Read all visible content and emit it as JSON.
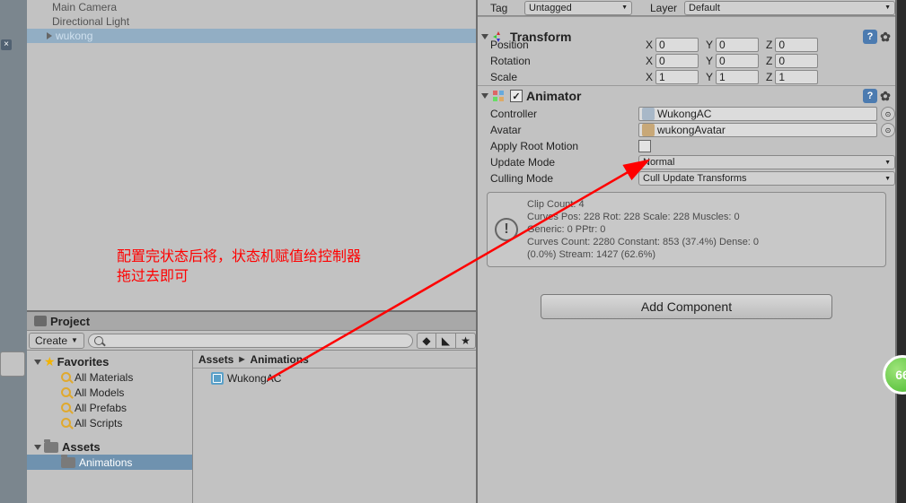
{
  "hierarchy": {
    "items": [
      "Main Camera",
      "Directional Light",
      "wukong"
    ]
  },
  "annotation": {
    "line1": "配置完状态后将，状态机赋值给控制器",
    "line2": "拖过去即可"
  },
  "project": {
    "tab": "Project",
    "create": "Create",
    "favorites": "Favorites",
    "fav_items": [
      "All Materials",
      "All Models",
      "All Prefabs",
      "All Scripts"
    ],
    "assets": "Assets",
    "assets_children": [
      "Animations"
    ],
    "breadcrumb": [
      "Assets",
      "Animations"
    ],
    "asset": "WukongAC"
  },
  "inspector": {
    "tag_label": "Tag",
    "tag_value": "Untagged",
    "layer_label": "Layer",
    "layer_value": "Default",
    "transform": {
      "title": "Transform",
      "position_label": "Position",
      "rotation_label": "Rotation",
      "scale_label": "Scale",
      "x": "X",
      "y": "Y",
      "z": "Z",
      "pos": [
        "0",
        "0",
        "0"
      ],
      "rot": [
        "0",
        "0",
        "0"
      ],
      "scale": [
        "1",
        "1",
        "1"
      ]
    },
    "animator": {
      "title": "Animator",
      "controller_label": "Controller",
      "controller_value": "WukongAC",
      "avatar_label": "Avatar",
      "avatar_value": "wukongAvatar",
      "apply_root_label": "Apply Root Motion",
      "update_mode_label": "Update Mode",
      "update_mode_value": "Normal",
      "culling_mode_label": "Culling Mode",
      "culling_mode_value": "Cull Update Transforms"
    },
    "info": {
      "l1": "Clip Count: 4",
      "l2": "Curves Pos: 228 Rot: 228 Scale: 228 Muscles: 0",
      "l3": "Generic: 0 PPtr: 0",
      "l4": "Curves Count: 2280 Constant: 853 (37.4%) Dense: 0",
      "l5": "(0.0%) Stream: 1427 (62.6%)"
    },
    "add_component": "Add Component"
  },
  "badge": "66"
}
